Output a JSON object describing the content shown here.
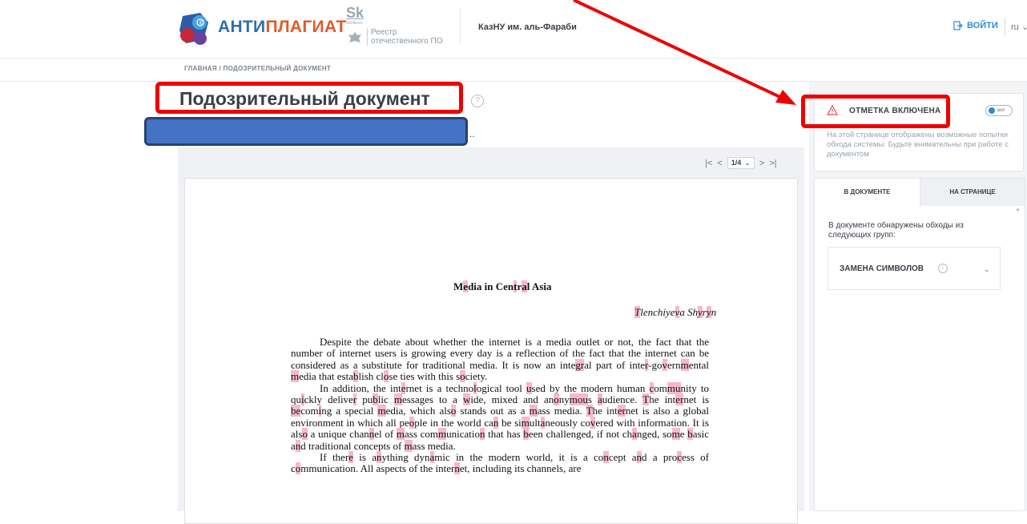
{
  "header": {
    "brand_part1": "АНТИ",
    "brand_part2": "ПЛАГИАТ",
    "sk_logo": "Sk",
    "sk_small": "Skolkovo",
    "registry_line1": "Реестр",
    "registry_line2": "отечественного ПО",
    "org": "КазНУ им. аль-Фараби",
    "login_label": "ВОЙТИ",
    "lang": "ru",
    "accent_color": "#2d6db5",
    "brand_highlight_color": "#e15a2c"
  },
  "breadcrumb": {
    "home": "ГЛАВНАЯ",
    "separator": "/",
    "current": "ПОДОЗРИТЕЛЬНЫЙ ДОКУМЕНТ"
  },
  "page": {
    "title": "Подозрительный документ",
    "help_icon": "?",
    "doc_name_tail": ".."
  },
  "viewer": {
    "first": "|<",
    "prev": "<",
    "page_value": "1/4",
    "next": ">",
    "last": ">|"
  },
  "document": {
    "title": "Media in Central Asia",
    "author": "Tlenchiyeva Shyryn"
  },
  "sidebar": {
    "alert_title": "ОТМЕТКА ВКЛЮЧЕНА",
    "toggle_label": "вкл",
    "alert_desc": "На этой странице отображены возможные попытки обхода системы. Будьте внимательны при работе с документом",
    "tab_in_doc": "В ДОКУМЕНТЕ",
    "tab_on_page": "НА СТРАНИЦЕ",
    "found_text": "В документе обнаружены обходы из следующих групп:",
    "group_label": "ЗАМЕНА СИМВОЛОВ",
    "alert_color": "#e34a4a",
    "toggle_color": "#2d8cd8"
  },
  "annotation": {
    "highlight_color": "#ee0000"
  }
}
